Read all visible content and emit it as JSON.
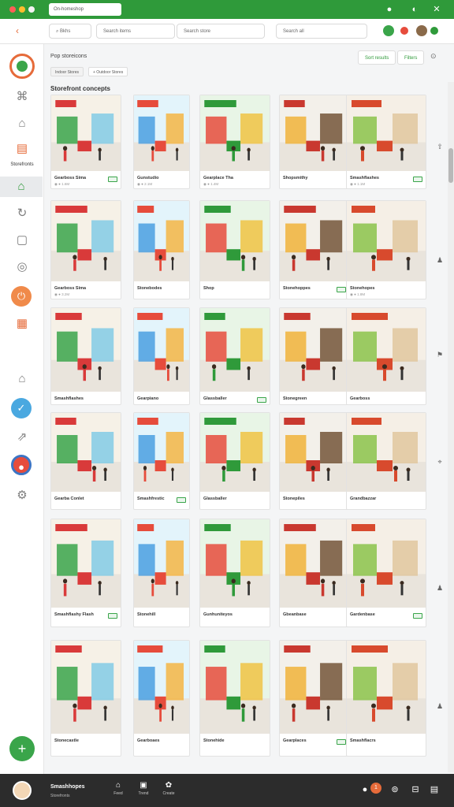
{
  "window": {
    "address": "On-homeshop",
    "dot_colors": [
      "#ff5f57",
      "#ffbd2e",
      "#28c840"
    ]
  },
  "toolbar": {
    "back_icon": "chevron-left-icon",
    "search_label": "Bkhs",
    "field_one": "Search items",
    "field_two": "Search store",
    "field_three": "Search all"
  },
  "sidebar": {
    "label": "Storefronts",
    "items": [
      "puzzle-icon",
      "tag-icon",
      "document-icon",
      "home-icon",
      "refresh-icon",
      "box-icon",
      "circle-icon",
      "power-icon",
      "calendar-icon",
      "shop-icon",
      "leaf-icon",
      "share-icon",
      "target-icon",
      "settings-icon"
    ],
    "fab_icon": "plus-icon"
  },
  "header": {
    "breadcrumb": "Pop storeicons",
    "pills": [
      "Indoor Stores",
      "+ Outdoor Stores"
    ],
    "btn_primary": "Sort results",
    "btn_secondary": "Filters"
  },
  "section_title": "Storefront concepts",
  "colors": {
    "brand": "#2f9a3a",
    "accent": "#e66b3a",
    "scene_palettes": [
      [
        "#f6f1e7",
        "#d93a3a",
        "#3aa54a",
        "#7cc9e6"
      ],
      [
        "#f3f0ea",
        "#c9382f",
        "#f0b33a",
        "#6b4b2d"
      ],
      [
        "#eef3f7",
        "#3c74c4",
        "#f7d24a",
        "#c8c8c8"
      ],
      [
        "#e3f4fb",
        "#e64c3c",
        "#4a9fe0",
        "#f5b23a"
      ],
      [
        "#f5efe6",
        "#d84a2d",
        "#8bc34a",
        "#e0c49a"
      ],
      [
        "#fbe8c8",
        "#f08a2a",
        "#d94d2d",
        "#7b5a3a"
      ],
      [
        "#e8f5e6",
        "#2f9a3a",
        "#e64c3c",
        "#f0c03a"
      ],
      [
        "#dff1f8",
        "#4a98d4",
        "#e35a8e",
        "#f5c84a"
      ]
    ]
  },
  "cards": [
    {
      "title": "Gearboss Sima",
      "meta": "◉ ● 1.6M"
    },
    {
      "title": "Gunstudio",
      "meta": "◉ ● 2.1M"
    },
    {
      "title": "Gearplace Tha",
      "meta": "◉ ● 1.4M"
    },
    {
      "title": "Shopsmithy",
      "meta": ""
    },
    {
      "title": "Smashflashes",
      "meta": "◉ ● 1.1M"
    },
    {
      "title": "Gearboss Sima",
      "meta": "◉ ● 3.2M"
    },
    {
      "title": "Stonebodes",
      "meta": ""
    },
    {
      "title": "Shop",
      "meta": ""
    },
    {
      "title": "Stonehoppes",
      "meta": ""
    },
    {
      "title": "Stonehopes",
      "meta": "◉ ● 1.8M"
    },
    {
      "title": "Smashflashes",
      "meta": ""
    },
    {
      "title": "Gearpiano",
      "meta": ""
    },
    {
      "title": "Glassballer",
      "meta": ""
    },
    {
      "title": "Stonegreen",
      "meta": ""
    },
    {
      "title": "Gearboss",
      "meta": ""
    },
    {
      "title": "Gearba Conlet",
      "meta": ""
    },
    {
      "title": "Smashfrestic",
      "meta": ""
    },
    {
      "title": "Glassballer",
      "meta": ""
    },
    {
      "title": "Stonepiles",
      "meta": ""
    },
    {
      "title": "Grandbazzar",
      "meta": ""
    },
    {
      "title": "Smashflashy Flash",
      "meta": ""
    },
    {
      "title": "Stonehill",
      "meta": ""
    },
    {
      "title": "Gunhuniteyos",
      "meta": ""
    },
    {
      "title": "Gbeanbase",
      "meta": ""
    },
    {
      "title": "Gardenbase",
      "meta": ""
    },
    {
      "title": "Stonecastle",
      "meta": ""
    },
    {
      "title": "Gearboaes",
      "meta": ""
    },
    {
      "title": "Stonehide",
      "meta": ""
    },
    {
      "title": "Gearplaces",
      "meta": ""
    },
    {
      "title": "Smashflacrs",
      "meta": ""
    }
  ],
  "rail_icons": [
    "share-icon",
    "user-icon",
    "flag-icon",
    "pin-icon",
    "person-icon",
    "user-icon"
  ],
  "bottombar": {
    "name": "Smashhopes",
    "sub": "Storefronts",
    "nav": [
      "Feed",
      "Trend",
      "Create"
    ],
    "icons": [
      "bell-icon",
      "settings-icon",
      "shop-icon",
      "grid-icon"
    ]
  }
}
